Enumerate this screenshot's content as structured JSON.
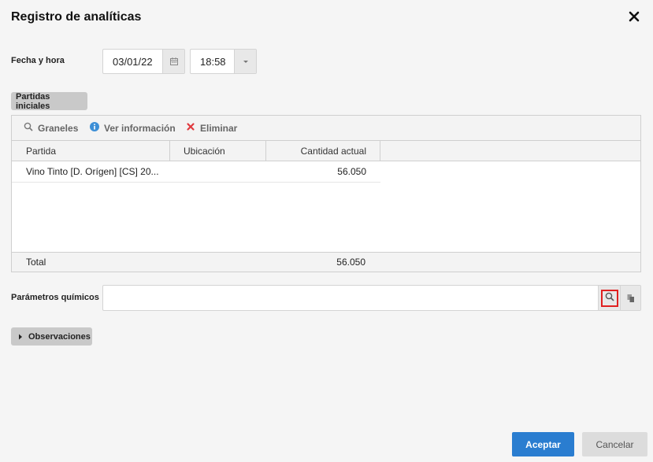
{
  "dialog": {
    "title": "Registro de analíticas"
  },
  "datetime": {
    "label": "Fecha y hora",
    "date_value": "03/01/22",
    "time_value": "18:58"
  },
  "partidas": {
    "section_label": "Partidas iniciales",
    "toolbar": {
      "graneles": "Graneles",
      "ver_info": "Ver información",
      "eliminar": "Eliminar"
    },
    "columns": [
      "Partida",
      "Ubicación",
      "Cantidad actual"
    ],
    "rows": [
      {
        "partida": "Vino Tinto [D. Orígen] [CS] 20...",
        "ubicacion": "",
        "cantidad": "56.050"
      }
    ],
    "footer": {
      "label": "Total",
      "cantidad": "56.050"
    }
  },
  "parametros": {
    "label": "Parámetros químicos",
    "value": ""
  },
  "observaciones": {
    "label": "Observaciones"
  },
  "actions": {
    "accept": "Aceptar",
    "cancel": "Cancelar"
  },
  "colors": {
    "primary": "#2a7dd0",
    "highlight": "#e02020",
    "delete": "#e0393e",
    "info": "#3d8fd6"
  }
}
